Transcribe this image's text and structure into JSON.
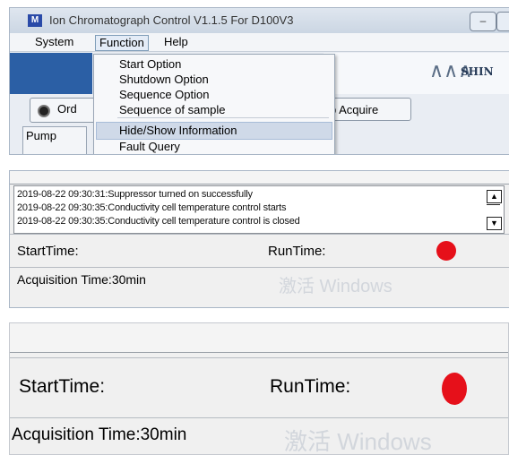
{
  "window": {
    "title": "Ion Chromatograph Control V1.1.5 For D100V3",
    "icon_letter": "M",
    "minimize_glyph": "–"
  },
  "menu": {
    "items": [
      "System",
      "Function",
      "Help"
    ],
    "function_dropdown": [
      "Start Option",
      "Shutdown Option",
      "Sequence Option",
      "Sequence of sample",
      "Hide/Show Information",
      "Fault Query"
    ],
    "highlighted": "Hide/Show Information"
  },
  "logo": {
    "text": "SHIN"
  },
  "controls": {
    "ord_button": "Ord",
    "acquire_button": "p Acquire",
    "pump_group": "Pump"
  },
  "log": {
    "lines": [
      "2019-08-22 09:30:31:Suppressor turned on successfully",
      "2019-08-22 09:30:35:Conductivity cell temperature control starts",
      "2019-08-22 09:30:35:Conductivity cell temperature control is closed"
    ],
    "scroll_up_glyph": "▲",
    "scroll_down_glyph": "▼"
  },
  "status": {
    "start_time_label": "StartTime:",
    "run_time_label": "RunTime:",
    "indicator_color": "#e6101a",
    "acquisition_time": "Acquisition Time:30min"
  },
  "watermark": {
    "partial": "激活 Windows",
    "full": "激活 Windows"
  },
  "colors": {
    "accent_blue": "#2b5fa5",
    "highlight": "#cfd9e8"
  }
}
